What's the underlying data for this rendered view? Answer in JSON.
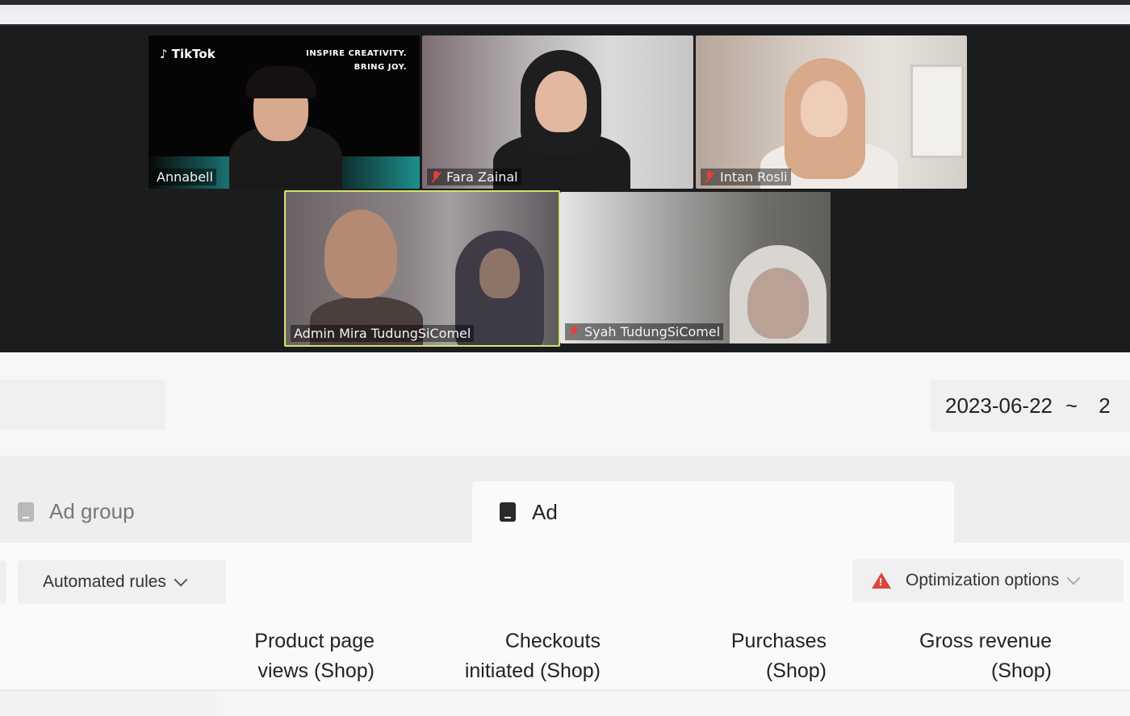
{
  "meeting": {
    "participants": [
      {
        "name": "Annabell",
        "muted": false,
        "brand": "TikTok",
        "slogan_line1": "INSPIRE CREATIVITY.",
        "slogan_line2": "BRING JOY."
      },
      {
        "name": "Fara Zainal",
        "muted": true
      },
      {
        "name": "Intan Rosli",
        "muted": true
      },
      {
        "name": "Admin Mira TudungSiComel",
        "muted": false,
        "active_speaker": true
      },
      {
        "name": "Syah TudungSiComel",
        "muted": true
      }
    ]
  },
  "date_range": {
    "start": "2023-06-22",
    "separator": "~",
    "end_partial": "2"
  },
  "tabs": [
    {
      "label": "Ad group",
      "selected": false,
      "icon": "ad-group-icon"
    },
    {
      "label": "Ad",
      "selected": true,
      "icon": "ad-icon"
    }
  ],
  "toolbar": {
    "automated_rules_label": "Automated rules",
    "optimization_label": "Optimization options"
  },
  "table": {
    "columns": [
      {
        "line1": "Product page",
        "line2": "views (Shop)"
      },
      {
        "line1": "Checkouts",
        "line2": "initiated (Shop)"
      },
      {
        "line1": "Purchases",
        "line2": "(Shop)"
      },
      {
        "line1": "Gross revenue",
        "line2": "(Shop)"
      }
    ]
  },
  "colors": {
    "accent_warning": "#d8473c",
    "active_speaker_border": "#d5e36a",
    "muted_mic": "#e0433a"
  }
}
